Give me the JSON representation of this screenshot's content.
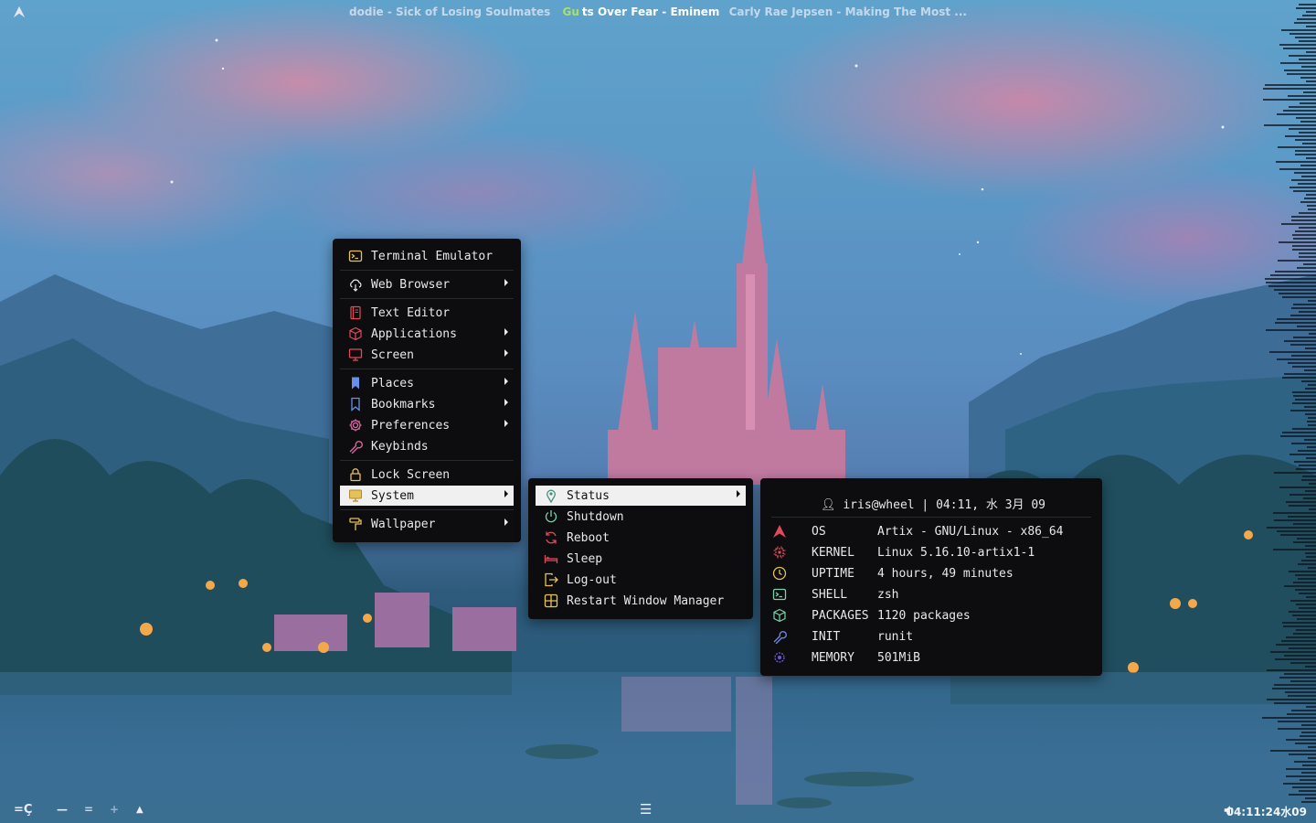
{
  "topbar": {
    "now_playing": [
      {
        "text": "dodie - Sick of Losing Soulmates",
        "state": "dim"
      },
      {
        "highlight": "Gu",
        "text": "ts Over Fear - Eminem",
        "state": "active"
      },
      {
        "text": "Carly Rae Jepsen - Making The Most ...",
        "state": "dim"
      }
    ]
  },
  "main_menu": {
    "items": [
      {
        "label": "Terminal Emulator",
        "icon": "terminal-icon",
        "submenu": false
      },
      {
        "label": "Web Browser",
        "icon": "cloud-download-icon",
        "submenu": true
      },
      {
        "label": "Text Editor",
        "icon": "notebook-icon",
        "submenu": false
      },
      {
        "label": "Applications",
        "icon": "package-icon",
        "submenu": true
      },
      {
        "label": "Screen",
        "icon": "monitor-icon",
        "submenu": true
      },
      {
        "label": "Places",
        "icon": "bookmark-filled-icon",
        "submenu": true
      },
      {
        "label": "Bookmarks",
        "icon": "bookmark-icon",
        "submenu": true
      },
      {
        "label": "Preferences",
        "icon": "gear-icon",
        "submenu": true
      },
      {
        "label": "Keybinds",
        "icon": "wrench-icon",
        "submenu": false
      },
      {
        "label": "Lock Screen",
        "icon": "lock-icon",
        "submenu": false
      },
      {
        "label": "System",
        "icon": "monitor-yellow-icon",
        "submenu": true,
        "selected": true
      },
      {
        "label": "Wallpaper",
        "icon": "paint-roller-icon",
        "submenu": true
      }
    ]
  },
  "system_menu": {
    "items": [
      {
        "label": "Status",
        "icon": "location-pin-icon",
        "submenu": true,
        "selected": true
      },
      {
        "label": "Shutdown",
        "icon": "power-icon",
        "submenu": false
      },
      {
        "label": "Reboot",
        "icon": "refresh-icon",
        "submenu": false
      },
      {
        "label": "Sleep",
        "icon": "bed-icon",
        "submenu": false
      },
      {
        "label": "Log-out",
        "icon": "logout-icon",
        "submenu": false
      },
      {
        "label": "Restart Window Manager",
        "icon": "window-grid-icon",
        "submenu": false
      }
    ]
  },
  "status_panel": {
    "header": "iris@wheel | 04:11, 水 3月 09",
    "rows": [
      {
        "key": "OS",
        "value": "Artix - GNU/Linux - x86_64",
        "icon": "artix-logo-icon"
      },
      {
        "key": "KERNEL",
        "value": "Linux 5.16.10-artix1-1",
        "icon": "cpu-icon"
      },
      {
        "key": "UPTIME",
        "value": "4 hours, 49 minutes",
        "icon": "clock-icon"
      },
      {
        "key": "SHELL",
        "value": "zsh",
        "icon": "terminal-icon"
      },
      {
        "key": "PACKAGES",
        "value": "1120 packages",
        "icon": "package-icon"
      },
      {
        "key": "INIT",
        "value": "runit",
        "icon": "wrench-icon"
      },
      {
        "key": "MEMORY",
        "value": "501MiB",
        "icon": "memory-icon"
      }
    ]
  },
  "bottombar": {
    "layout_symbol": "=Ç",
    "workspaces": [
      "—",
      "=",
      "+",
      "▲"
    ],
    "center_menu_icon": "☰",
    "clock": "04:11:24水09"
  },
  "colors": {
    "menu_bg": "#0d0d0f",
    "selected_bg": "#f0f0f0",
    "accent_red": "#e24a5a",
    "accent_yellow": "#e6c15a",
    "accent_green": "#7fd0a8",
    "accent_blue": "#6a8fe8"
  }
}
